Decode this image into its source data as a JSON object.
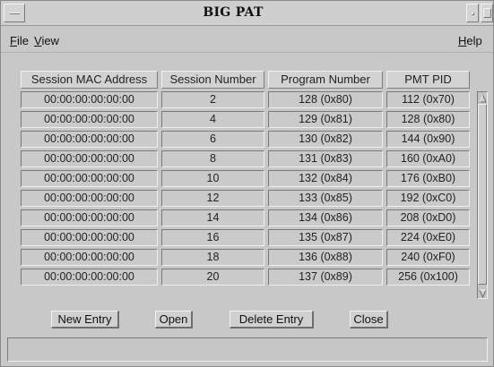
{
  "window": {
    "title": "BIG PAT",
    "window_menu_icon": "window-menu-icon",
    "minimize_icon": "minimize-icon",
    "maximize_icon": "maximize-icon"
  },
  "menubar": {
    "file": "File",
    "view": "View",
    "help": "Help"
  },
  "table": {
    "headers": [
      "Session MAC Address",
      "Session Number",
      "Program Number",
      "PMT PID"
    ],
    "rows": [
      [
        "00:00:00:00:00:00",
        "2",
        "128 (0x80)",
        "112 (0x70)"
      ],
      [
        "00:00:00:00:00:00",
        "4",
        "129 (0x81)",
        "128 (0x80)"
      ],
      [
        "00:00:00:00:00:00",
        "6",
        "130 (0x82)",
        "144 (0x90)"
      ],
      [
        "00:00:00:00:00:00",
        "8",
        "131 (0x83)",
        "160 (0xA0)"
      ],
      [
        "00:00:00:00:00:00",
        "10",
        "132 (0x84)",
        "176 (0xB0)"
      ],
      [
        "00:00:00:00:00:00",
        "12",
        "133 (0x85)",
        "192 (0xC0)"
      ],
      [
        "00:00:00:00:00:00",
        "14",
        "134 (0x86)",
        "208 (0xD0)"
      ],
      [
        "00:00:00:00:00:00",
        "16",
        "135 (0x87)",
        "224 (0xE0)"
      ],
      [
        "00:00:00:00:00:00",
        "18",
        "136 (0x88)",
        "240 (0xF0)"
      ],
      [
        "00:00:00:00:00:00",
        "20",
        "137 (0x89)",
        "256 (0x100)"
      ]
    ],
    "scroll_up_icon": "scroll-up-arrow-icon",
    "scroll_down_icon": "scroll-down-arrow-icon"
  },
  "buttons": {
    "new_entry": "New Entry",
    "open": "Open",
    "delete_entry": "Delete Entry",
    "close": "Close"
  },
  "statusbar": {
    "text": ""
  },
  "colors": {
    "background": "#c8c8c8",
    "cell_background": "#cacaca",
    "text": "#1a1a1a",
    "bevel_light": "#f2f2f2",
    "bevel_dark": "#7a7a7a"
  }
}
